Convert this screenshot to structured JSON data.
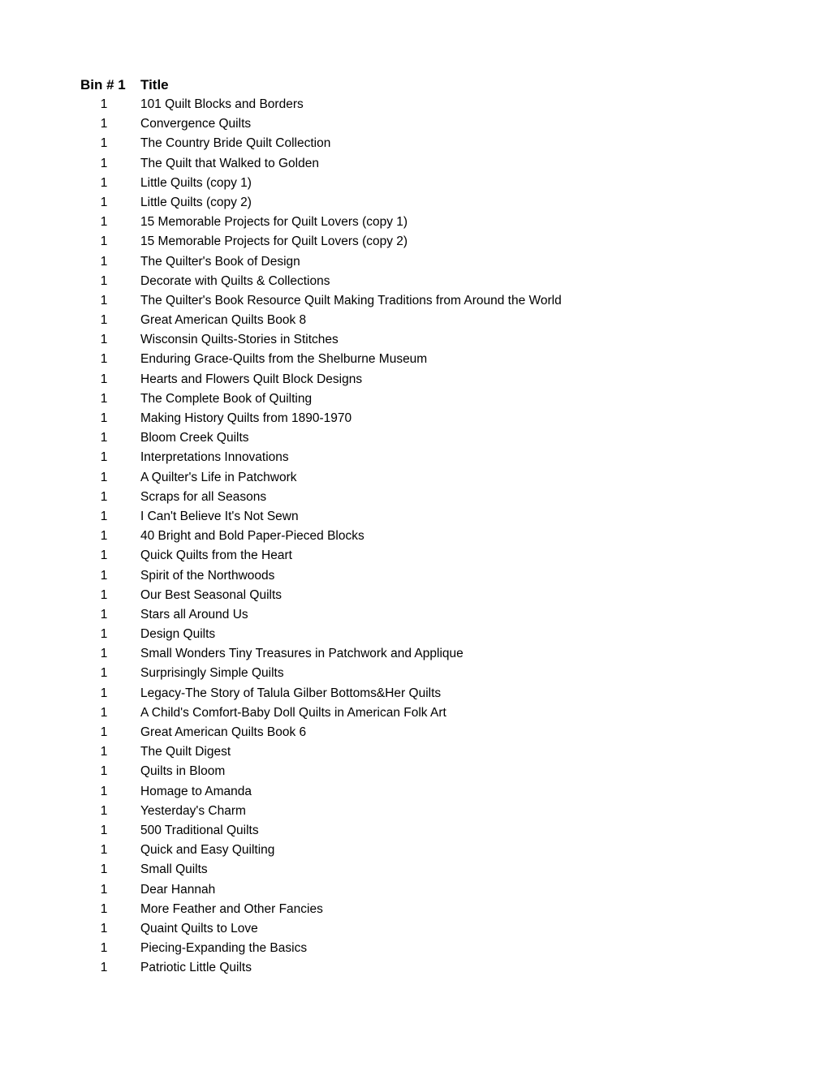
{
  "header": {
    "bin_label": "Bin # 1",
    "title_label": "Title"
  },
  "rows": [
    {
      "bin": "1",
      "title": "101 Quilt Blocks and Borders"
    },
    {
      "bin": "1",
      "title": "Convergence Quilts"
    },
    {
      "bin": "1",
      "title": "The Country Bride Quilt Collection"
    },
    {
      "bin": "1",
      "title": "The Quilt that Walked to Golden"
    },
    {
      "bin": "1",
      "title": "Little Quilts (copy 1)"
    },
    {
      "bin": "1",
      "title": "Little Quilts (copy 2)"
    },
    {
      "bin": "1",
      "title": "15  Memorable Projects for Quilt Lovers (copy 1)"
    },
    {
      "bin": "1",
      "title": "15 Memorable Projects for Quilt Lovers (copy 2)"
    },
    {
      "bin": "1",
      "title": "The Quilter's Book of Design"
    },
    {
      "bin": "1",
      "title": "Decorate with Quilts & Collections"
    },
    {
      "bin": "1",
      "title": "The Quilter's Book Resource Quilt Making Traditions from Around the World"
    },
    {
      "bin": "1",
      "title": "Great American Quilts Book 8"
    },
    {
      "bin": "1",
      "title": "Wisconsin Quilts-Stories in Stitches"
    },
    {
      "bin": "1",
      "title": "Enduring Grace-Quilts from the Shelburne Museum"
    },
    {
      "bin": "1",
      "title": "Hearts and Flowers Quilt Block Designs"
    },
    {
      "bin": "1",
      "title": "The Complete Book of Quilting"
    },
    {
      "bin": "1",
      "title": "Making History Quilts from 1890-1970"
    },
    {
      "bin": "1",
      "title": "Bloom Creek Quilts"
    },
    {
      "bin": "1",
      "title": "Interpretations Innovations"
    },
    {
      "bin": "1",
      "title": "A Quilter's Life in Patchwork"
    },
    {
      "bin": "1",
      "title": "Scraps for all Seasons"
    },
    {
      "bin": "1",
      "title": "I Can't Believe It's Not Sewn"
    },
    {
      "bin": "1",
      "title": "40 Bright and Bold Paper-Pieced Blocks"
    },
    {
      "bin": "1",
      "title": "Quick Quilts from the Heart"
    },
    {
      "bin": "1",
      "title": "Spirit of the Northwoods"
    },
    {
      "bin": "1",
      "title": "Our Best Seasonal Quilts"
    },
    {
      "bin": "1",
      "title": "Stars all Around Us"
    },
    {
      "bin": "1",
      "title": "Design Quilts"
    },
    {
      "bin": "1",
      "title": "Small Wonders Tiny Treasures in Patchwork and Applique"
    },
    {
      "bin": "1",
      "title": "Surprisingly Simple Quilts"
    },
    {
      "bin": "1",
      "title": "Legacy-The Story of Talula Gilber Bottoms&Her Quilts"
    },
    {
      "bin": "1",
      "title": "A Child's Comfort-Baby Doll Quilts in American Folk Art"
    },
    {
      "bin": "1",
      "title": "Great American Quilts Book 6"
    },
    {
      "bin": "1",
      "title": "The Quilt Digest"
    },
    {
      "bin": "1",
      "title": "Quilts in Bloom"
    },
    {
      "bin": "1",
      "title": "Homage to Amanda"
    },
    {
      "bin": "1",
      "title": "Yesterday's Charm"
    },
    {
      "bin": "1",
      "title": "500 Traditional Quilts"
    },
    {
      "bin": "1",
      "title": "Quick and Easy Quilting"
    },
    {
      "bin": "1",
      "title": "Small Quilts"
    },
    {
      "bin": "1",
      "title": "Dear Hannah"
    },
    {
      "bin": "1",
      "title": "More Feather and Other Fancies"
    },
    {
      "bin": "1",
      "title": "Quaint Quilts to Love"
    },
    {
      "bin": "1",
      "title": "Piecing-Expanding the Basics"
    },
    {
      "bin": "1",
      "title": "Patriotic Little Quilts"
    }
  ]
}
